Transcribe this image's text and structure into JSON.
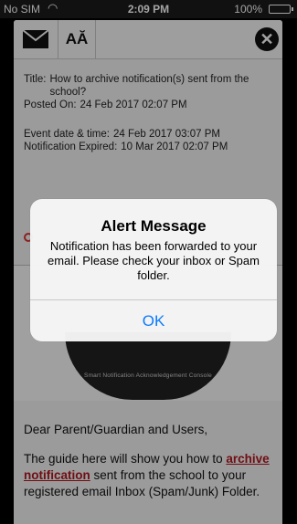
{
  "status_bar": {
    "carrier": "No SIM",
    "time": "2:09 PM",
    "battery": "100%",
    "wifi_icon": "wifi-icon",
    "battery_icon": "battery-icon"
  },
  "toolbar": {
    "mail_icon": "mail-icon",
    "font_label": "AĂ",
    "close_icon": "close-icon"
  },
  "notification": {
    "title_label": "Title:",
    "title_value": "How to archive notification(s) sent from the school?",
    "posted_label": "Posted On:",
    "posted_value": "24 Feb 2017 02:07 PM",
    "event_label": "Event date & time:",
    "event_value": "24 Feb 2017 03:07 PM",
    "expired_label": "Notification Expired:",
    "expired_value": "10 Mar 2017 02:07 PM"
  },
  "logo": {
    "caption": "Smart Notification Acknowledgement Console"
  },
  "content": {
    "greeting": "Dear Parent/Guardian and Users,",
    "body_prefix": "The guide here will show you how to ",
    "link_text": "archive notification",
    "body_suffix": " sent from the school to your registered email Inbox (Spam/Junk) Folder."
  },
  "alert": {
    "title": "Alert Message",
    "message": "Notification has been forwarded to your email. Please check your inbox or Spam folder.",
    "ok_label": "OK"
  },
  "colors": {
    "link": "#b0171f",
    "ios_blue": "#0a7aff"
  }
}
